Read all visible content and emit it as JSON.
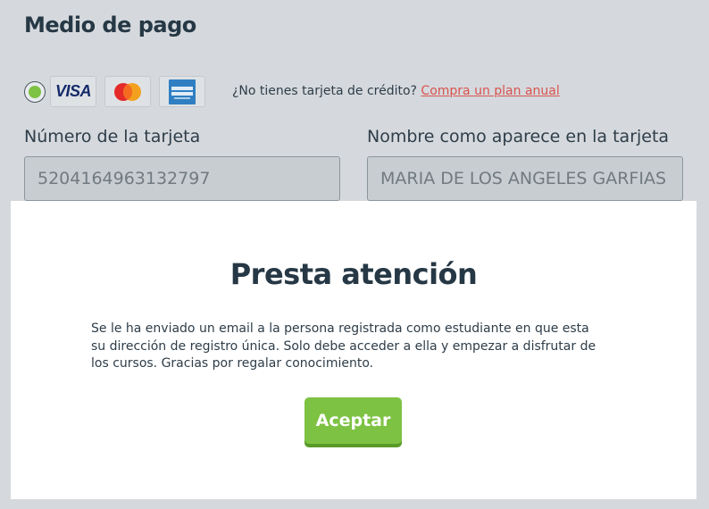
{
  "payment": {
    "title": "Medio de pago",
    "card_brands": {
      "visa": "VISA",
      "mastercard": "MasterCard",
      "amex": "AMERICAN EXPRESS"
    },
    "no_card_text": "¿No tienes tarjeta de crédito?",
    "no_card_link": "Compra un plan anual",
    "card_number_label": "Número de la tarjeta",
    "card_number_value": "5204164963132797",
    "card_name_label": "Nombre como aparece en la tarjeta",
    "card_name_value": "MARIA DE LOS ANGELES GARFIAS"
  },
  "modal": {
    "title": "Presta atención",
    "body": "Se le ha enviado un email a la persona registrada como estudiante en que esta su dirección de registro única. Solo debe acceder a ella y empezar a disfrutar de los cursos. Gracias por regalar conocimiento.",
    "accept_label": "Aceptar"
  },
  "colors": {
    "background": "#d5d9dd",
    "accent_green": "#7dc243",
    "link_red": "#d9534f",
    "heading": "#263845"
  },
  "icons": {
    "radio": "radio-selected-icon",
    "visa": "visa-icon",
    "mastercard": "mastercard-icon",
    "amex": "amex-icon"
  }
}
